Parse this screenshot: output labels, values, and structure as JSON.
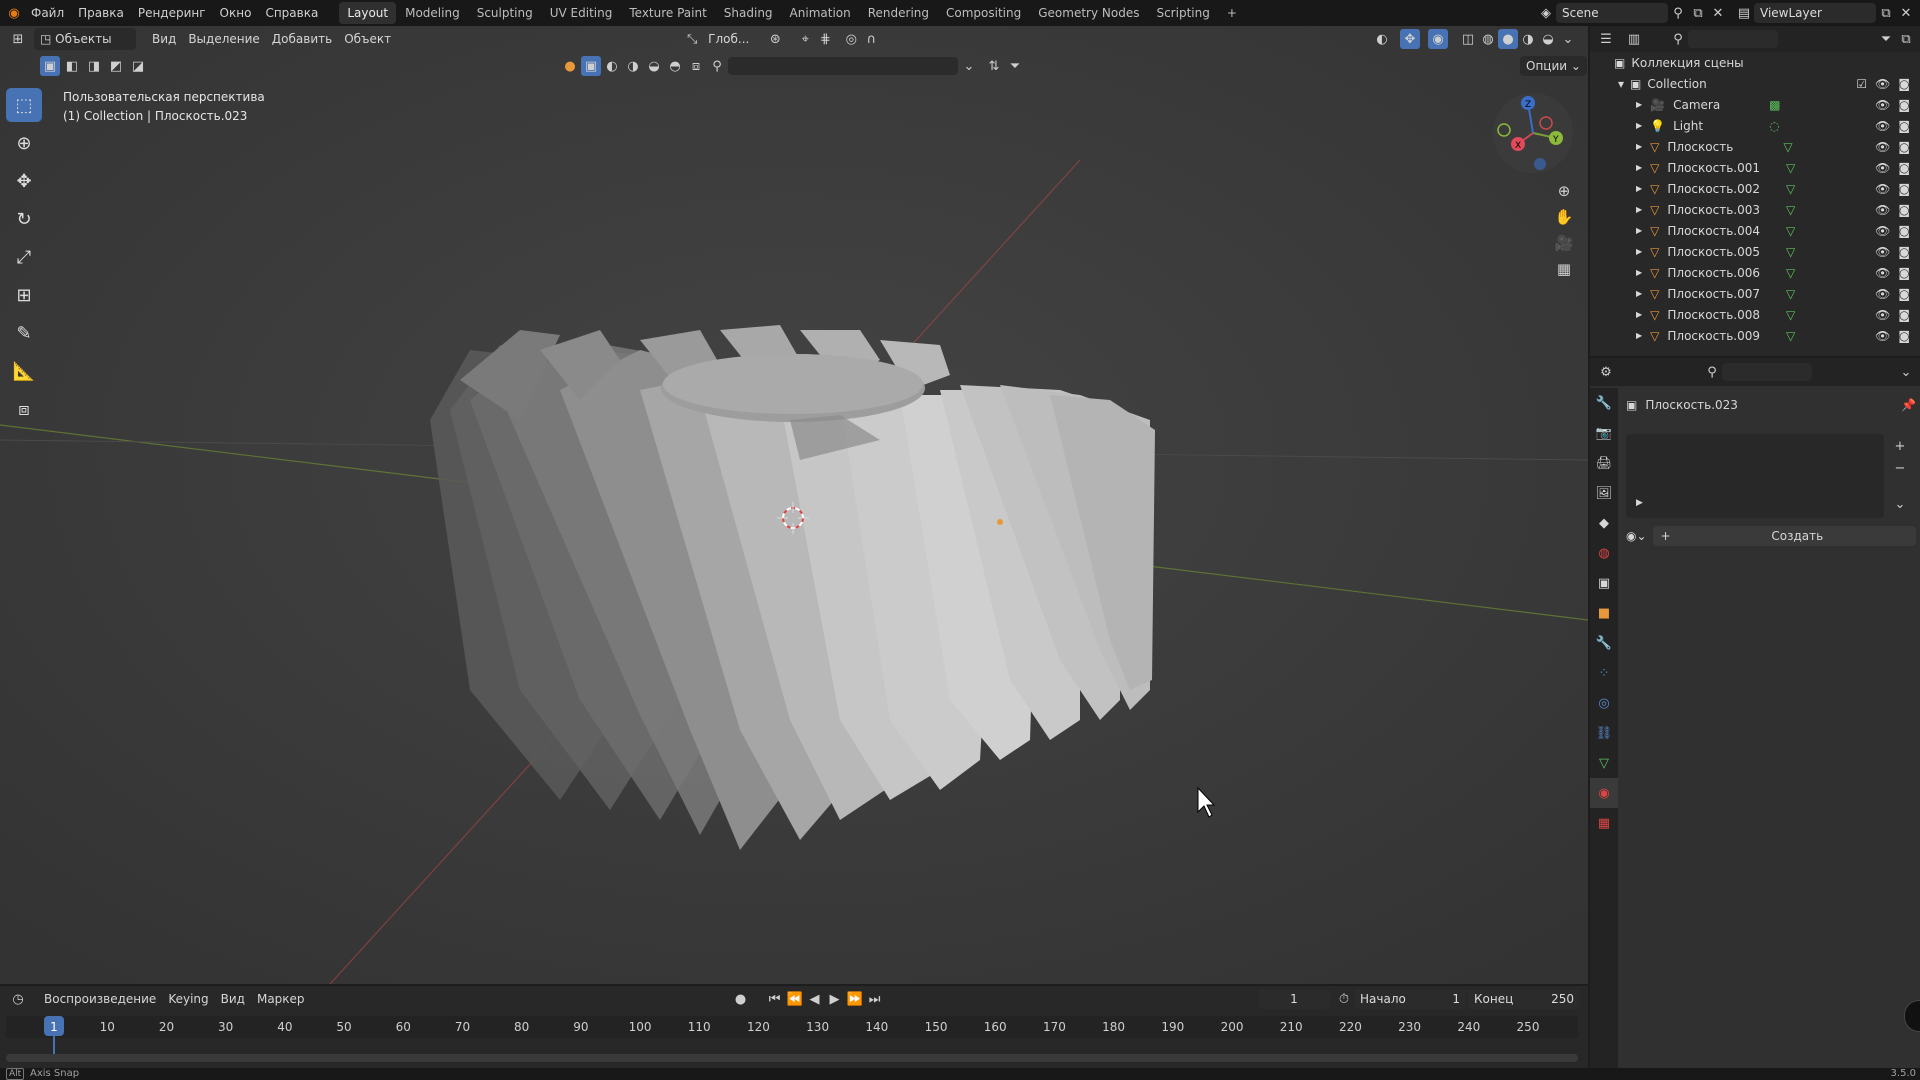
{
  "top_menu": {
    "items": [
      "Файл",
      "Правка",
      "Рендеринг",
      "Окно",
      "Справка"
    ],
    "workspaces": [
      "Layout",
      "Modeling",
      "Sculpting",
      "UV Editing",
      "Texture Paint",
      "Shading",
      "Animation",
      "Rendering",
      "Compositing",
      "Geometry Nodes",
      "Scripting"
    ],
    "active_workspace": "Layout",
    "add_tab": "+",
    "scene": "Scene",
    "view_layer": "ViewLayer"
  },
  "viewport_header": {
    "mode": "Объекты",
    "menus": [
      "Вид",
      "Выделение",
      "Добавить",
      "Объект"
    ],
    "orientation": "Глоб...",
    "options": "Опции"
  },
  "viewport": {
    "view_name": "Пользовательская перспектива",
    "collection_info": "(1) Collection | Плоскость.023"
  },
  "outliner": {
    "root": "Коллекция сцены",
    "collection": "Collection",
    "items": [
      {
        "name": "Camera",
        "type": "camera"
      },
      {
        "name": "Light",
        "type": "light"
      },
      {
        "name": "Плоскость",
        "type": "mesh"
      },
      {
        "name": "Плоскость.001",
        "type": "mesh"
      },
      {
        "name": "Плоскость.002",
        "type": "mesh"
      },
      {
        "name": "Плоскость.003",
        "type": "mesh"
      },
      {
        "name": "Плоскость.004",
        "type": "mesh"
      },
      {
        "name": "Плоскость.005",
        "type": "mesh"
      },
      {
        "name": "Плоскость.006",
        "type": "mesh"
      },
      {
        "name": "Плоскость.007",
        "type": "mesh"
      },
      {
        "name": "Плоскость.008",
        "type": "mesh"
      },
      {
        "name": "Плоскость.009",
        "type": "mesh"
      }
    ]
  },
  "properties": {
    "object_name": "Плоскость.023",
    "create_button": "Создать"
  },
  "timeline": {
    "menus": [
      "Воспроизведение",
      "Keying",
      "Вид",
      "Маркер"
    ],
    "current_frame": "1",
    "start_label": "Начало",
    "start": "1",
    "end_label": "Конец",
    "end": "250",
    "ticks": [
      "1",
      "10",
      "20",
      "30",
      "40",
      "50",
      "60",
      "70",
      "80",
      "90",
      "100",
      "110",
      "120",
      "130",
      "140",
      "150",
      "160",
      "170",
      "180",
      "190",
      "200",
      "210",
      "220",
      "230",
      "240",
      "250"
    ]
  },
  "status": {
    "key": "Alt",
    "hint": "Axis Snap",
    "version": "3.5.0"
  },
  "colors": {
    "accent": "#4772b3",
    "mesh_icon": "#e8973a",
    "data_icon": "#5cc25c",
    "viewport_bg": "#3d3d3d",
    "axis_x": "#b84a4a",
    "axis_y": "#7a9a3a"
  }
}
